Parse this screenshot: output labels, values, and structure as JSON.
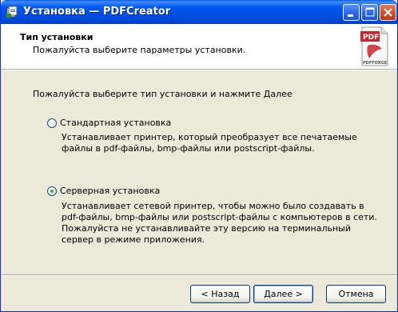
{
  "window": {
    "title": "Установка — PDFCreator",
    "accent_color": "#0054e3",
    "app_icon": "installer-icon"
  },
  "header": {
    "title": "Тип установки",
    "subtitle": "Пожалуйста выберите параметры установки.",
    "logo_text": "PDF",
    "logo_caption": "PDFFORGE"
  },
  "main": {
    "instruction": "Пожалуйста выберите тип установки и нажмите Далее",
    "options": [
      {
        "label": "Стандартная установка",
        "selected": false,
        "description": "Устанавливает принтер, который преобразует все печатаемые\nфайлы в pdf-файлы, bmp-файлы или postscript-файлы."
      },
      {
        "label": "Серверная установка",
        "selected": true,
        "description": "Устанавливает сетевой принтер, чтобы можно было создавать в\npdf-файлы, bmp-файлы или postscript-файлы с компьютеров в сети.\nПожалуйста не устанавливайте эту версию на терминальный\nсервер  в режиме приложения."
      }
    ]
  },
  "buttons": {
    "back": "< Назад",
    "next": "Далее >",
    "cancel": "Отмена"
  }
}
